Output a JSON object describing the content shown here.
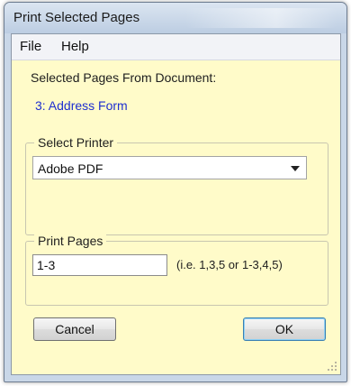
{
  "window": {
    "title": "Print Selected Pages"
  },
  "menu": {
    "items": [
      "File",
      "Help"
    ]
  },
  "selected_pages": {
    "label": "Selected Pages From Document:",
    "items": [
      "3: Address Form"
    ]
  },
  "printer": {
    "group_title": "Select Printer",
    "selected": "Adobe PDF"
  },
  "pages": {
    "group_title": "Print Pages",
    "value": "1-3",
    "hint": "(i.e. 1,3,5 or 1-3,4,5)"
  },
  "buttons": {
    "cancel": "Cancel",
    "ok": "OK"
  },
  "colors": {
    "client_background": "#fffbc9",
    "page_link": "#1e2fd0"
  }
}
